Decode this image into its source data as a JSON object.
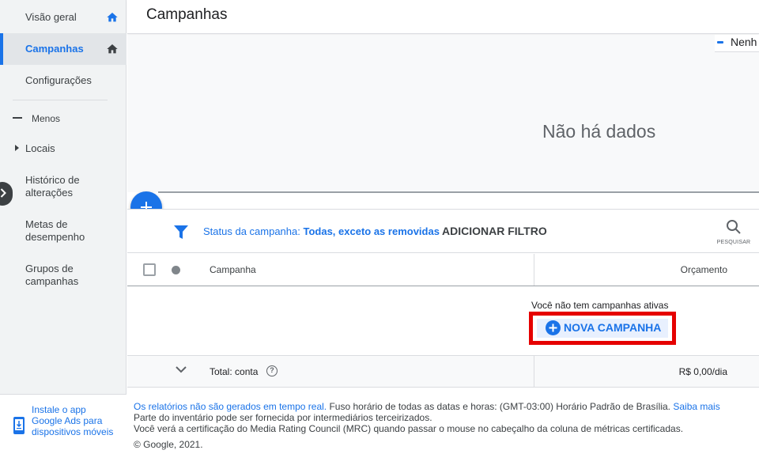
{
  "sidebar": {
    "items": [
      {
        "label": "Visão geral"
      },
      {
        "label": "Campanhas"
      },
      {
        "label": "Configurações"
      },
      {
        "label": "Menos"
      },
      {
        "label": "Locais"
      },
      {
        "label": "Histórico de alterações"
      },
      {
        "label": "Metas de desempenho"
      },
      {
        "label": "Grupos de campanhas"
      }
    ],
    "install": "Instale o app Google Ads para dispositivos móveis"
  },
  "header": {
    "title": "Campanhas"
  },
  "chart": {
    "legend": "Nenh",
    "empty_text": "Não há dados"
  },
  "filter": {
    "label": "Status da campanha:",
    "value": "Todas, exceto as removidas",
    "add_filter": "ADICIONAR FILTRO",
    "search_caption": "PESQUISAR"
  },
  "table": {
    "col_campaign": "Campanha",
    "col_budget": "Orçamento",
    "empty_message": "Você não tem campanhas ativas",
    "new_campaign": "NOVA CAMPANHA",
    "total_label": "Total: conta",
    "total_budget": "R$ 0,00/dia"
  },
  "footer": {
    "reports_link": "Os relatórios não são gerados em tempo real.",
    "timezone": " Fuso horário de todas as datas e horas: (GMT-03:00) Horário Padrão de Brasília. ",
    "learn_more": "Saiba mais",
    "inventory": "Parte do inventário pode ser fornecida por intermediários terceirizados.",
    "mrc": "Você verá a certificação do Media Rating Council (MRC) quando passar o mouse no cabeçalho da coluna de métricas certificadas.",
    "copyright": "© Google, 2021."
  },
  "colors": {
    "accent": "#1a73e8",
    "highlight_box": "#e50000"
  }
}
